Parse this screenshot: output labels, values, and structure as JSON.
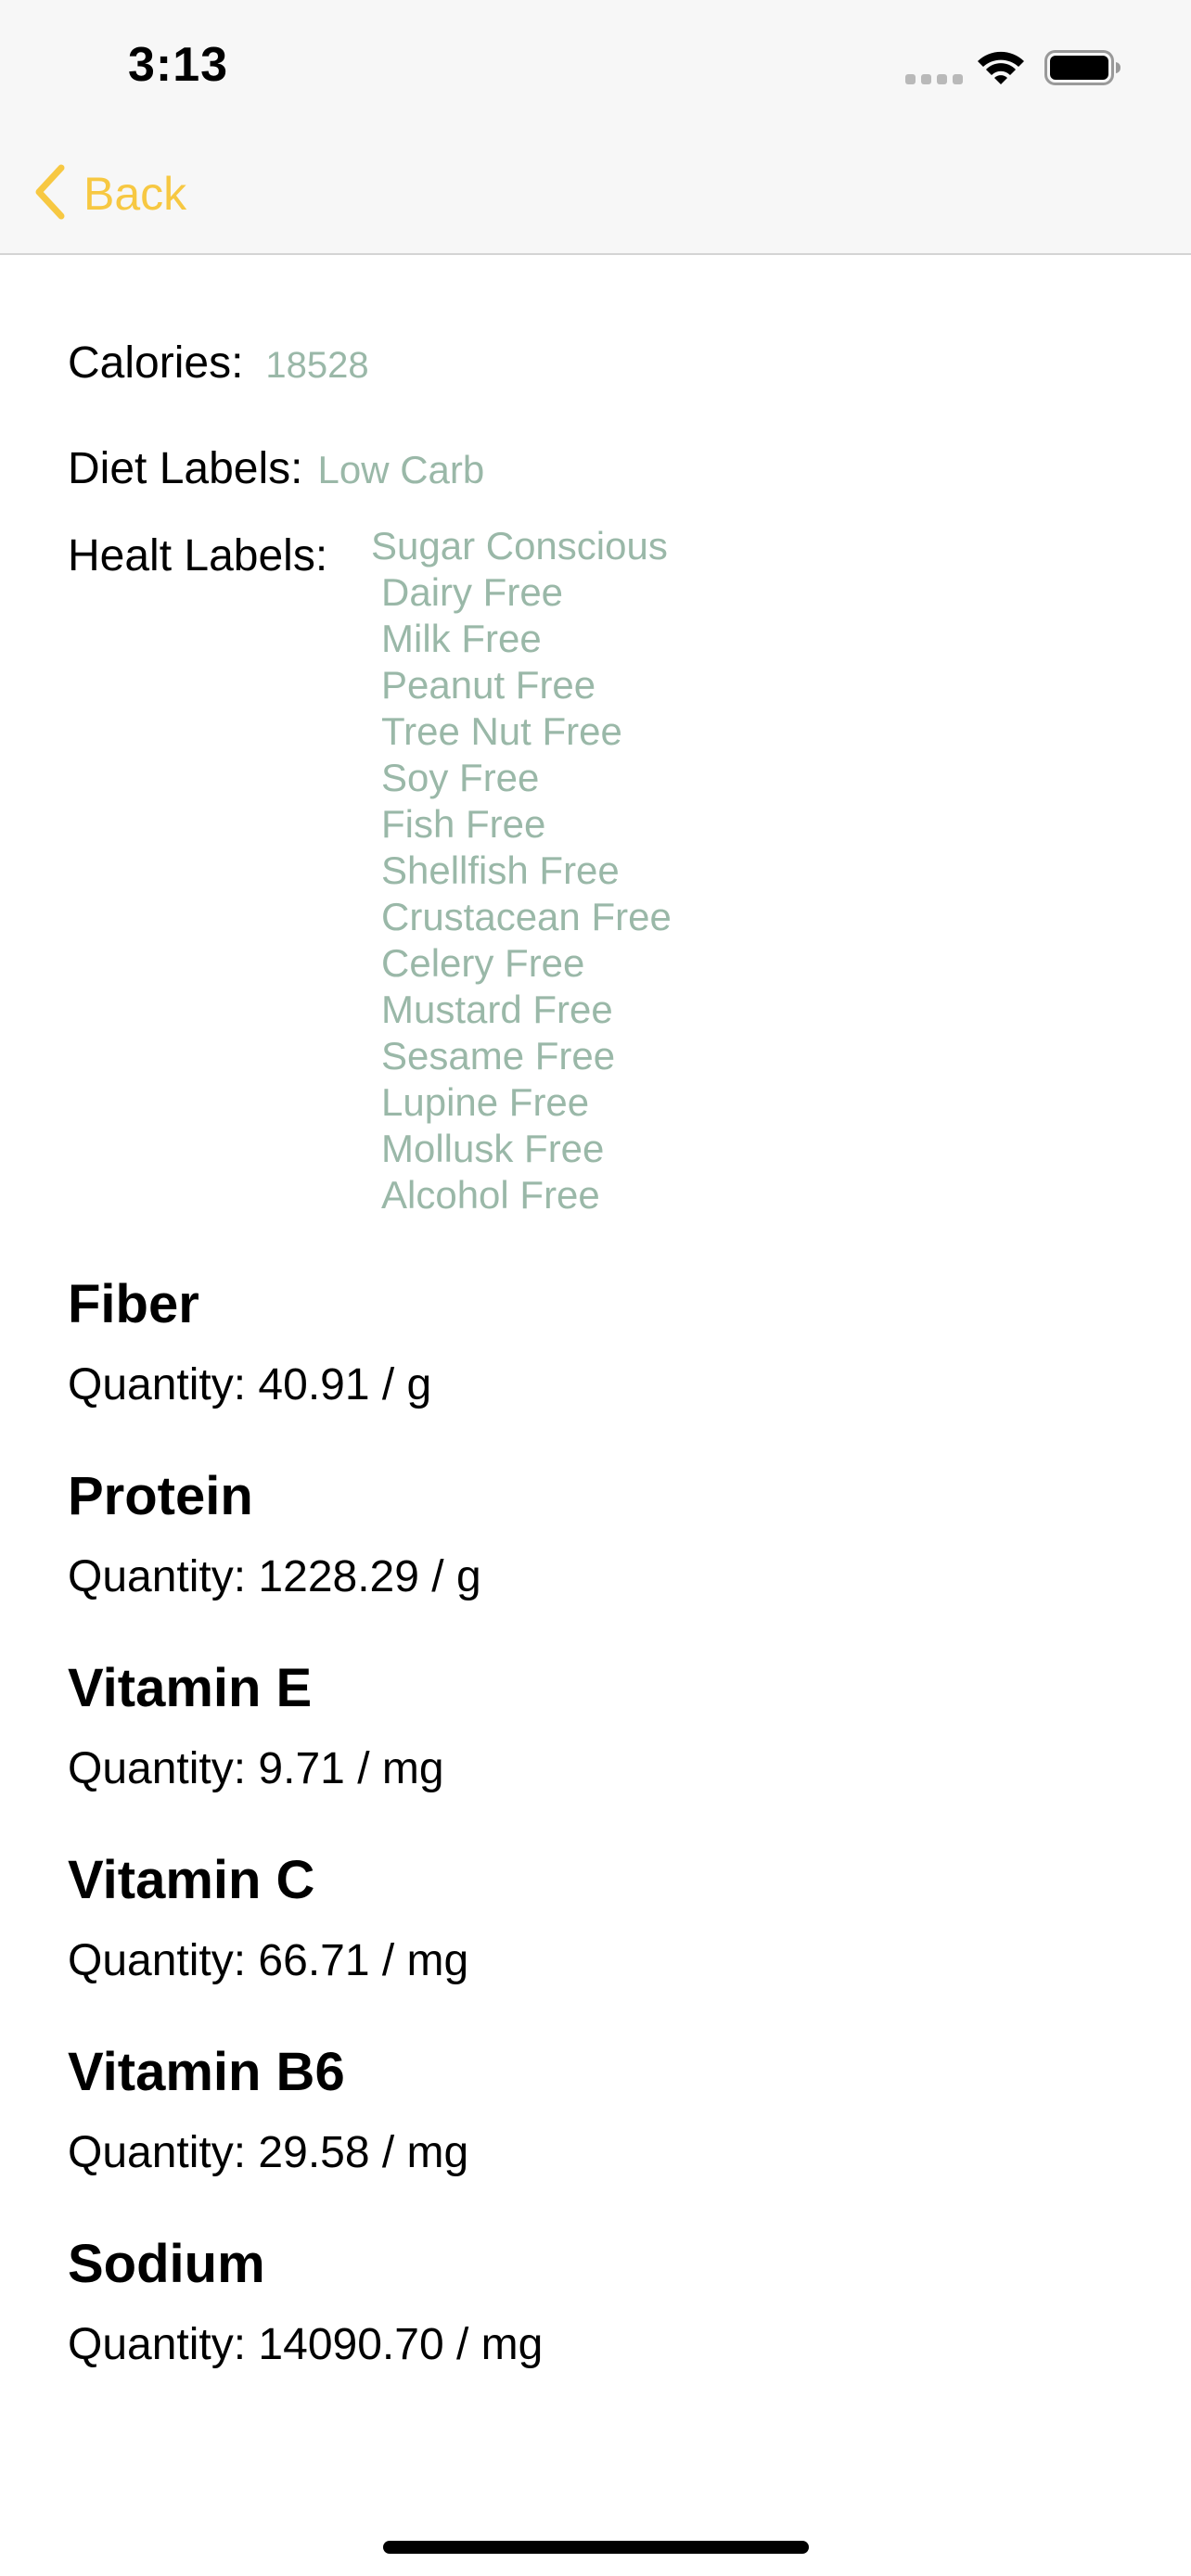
{
  "status_bar": {
    "time": "3:13"
  },
  "nav": {
    "back_label": "Back"
  },
  "info": {
    "calories_label": "Calories:",
    "calories_value": "18528",
    "diet_label": "Diet Labels:",
    "diet_value": "Low Carb",
    "health_label": "Healt Labels:",
    "health_items": [
      "Sugar Conscious",
      "Dairy Free",
      "Milk Free",
      "Peanut Free",
      "Tree Nut Free",
      "Soy Free",
      "Fish Free",
      "Shellfish Free",
      "Crustacean Free",
      "Celery Free",
      "Mustard Free",
      "Sesame Free",
      "Lupine Free",
      "Mollusk Free",
      "Alcohol Free"
    ]
  },
  "nutrients": [
    {
      "name": "Fiber",
      "quantity": "Quantity: 40.91 / g"
    },
    {
      "name": "Protein",
      "quantity": "Quantity: 1228.29 / g"
    },
    {
      "name": "Vitamin E",
      "quantity": "Quantity: 9.71 / mg"
    },
    {
      "name": "Vitamin C",
      "quantity": "Quantity: 66.71 / mg"
    },
    {
      "name": "Vitamin B6",
      "quantity": "Quantity: 29.58 / mg"
    },
    {
      "name": "Sodium",
      "quantity": "Quantity: 14090.70 / mg"
    }
  ],
  "colors": {
    "accent": "#f7c842",
    "label_value": "#9ab8a8"
  }
}
